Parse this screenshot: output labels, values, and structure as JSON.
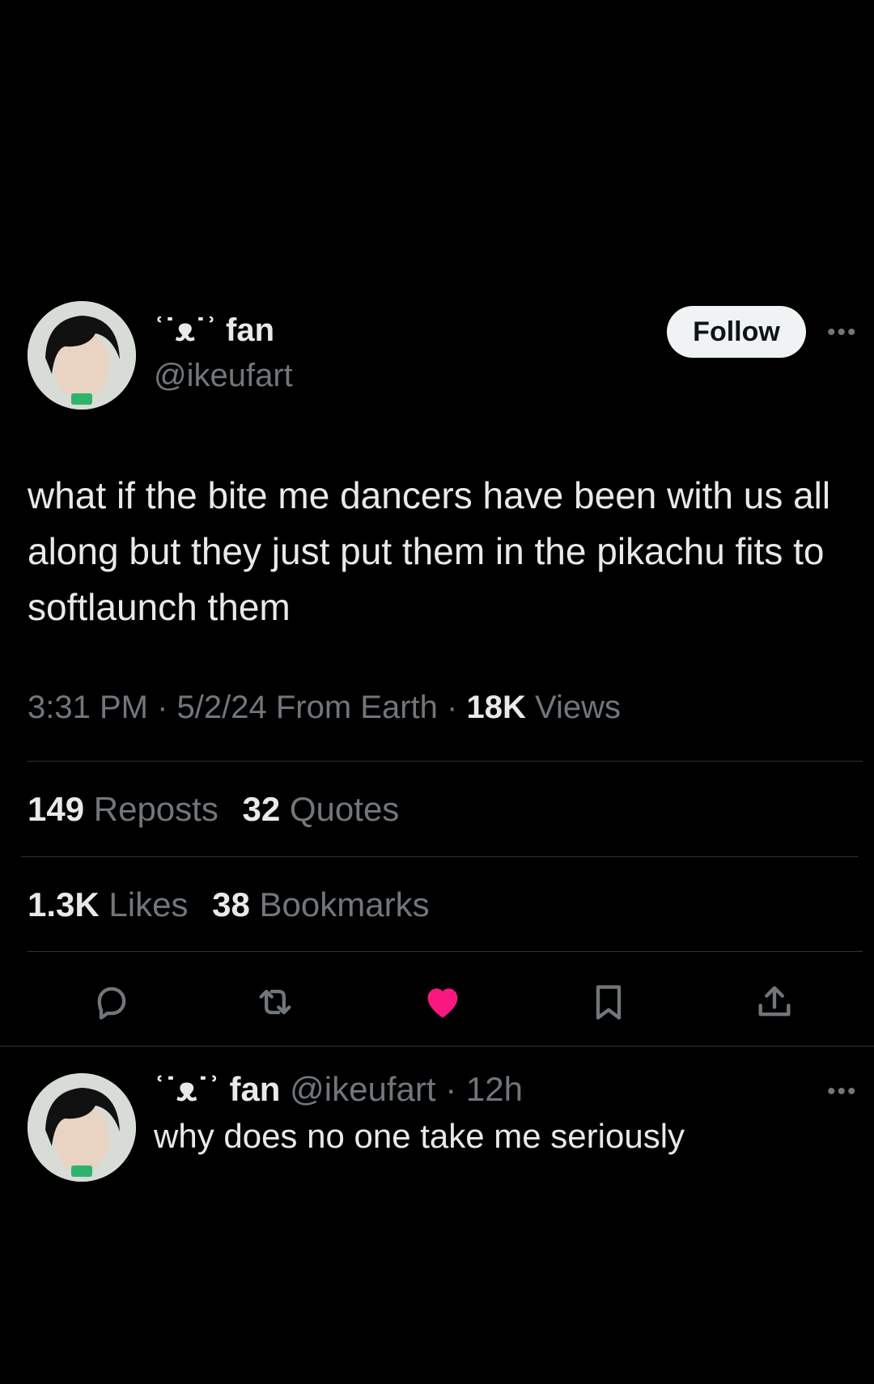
{
  "tweet": {
    "display_name": "ʿ˙ᴥ˙ʾ fan",
    "handle": "@ikeufart",
    "follow_label": "Follow",
    "more_label": "•••",
    "text": "what if the bite me dancers have been with us all along but they just put them in the pikachu fits to softlaunch them",
    "time": "3:31 PM",
    "date": "5/2/24",
    "source": "From Earth",
    "views_count": "18K",
    "views_label": "Views",
    "reposts_count": "149",
    "reposts_label": "Reposts",
    "quotes_count": "32",
    "quotes_label": "Quotes",
    "likes_count": "1.3K",
    "likes_label": "Likes",
    "bookmarks_count": "38",
    "bookmarks_label": "Bookmarks",
    "liked": true
  },
  "reply": {
    "display_name": "ʿ˙ᴥ˙ʾ fan",
    "handle": "@ikeufart",
    "time": "12h",
    "text": "why does no one take me seriously",
    "more_label": "•••"
  },
  "icons": {
    "reply": "reply-icon",
    "repost": "repost-icon",
    "like": "heart-icon",
    "bookmark": "bookmark-icon",
    "share": "share-icon"
  },
  "colors": {
    "background": "#000000",
    "text_primary": "#e7e9ea",
    "text_secondary": "#71767b",
    "like_pink": "#f91880",
    "divider": "#2f3336"
  }
}
